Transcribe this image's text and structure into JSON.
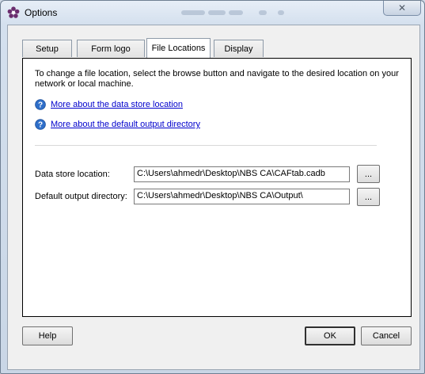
{
  "window": {
    "title": "Options",
    "close_glyph": "✕",
    "app_icon": "purple-flower-icon",
    "accent": "#6b2d6e"
  },
  "tabs": [
    {
      "label": "Setup",
      "active": false
    },
    {
      "label": "Form logo",
      "active": false
    },
    {
      "label": "File Locations",
      "active": true
    },
    {
      "label": "Display",
      "active": false
    }
  ],
  "panel": {
    "intro": "To change a file location, select the browse button and navigate to the desired location on your network or local machine.",
    "help_links": [
      {
        "text": "More about the data store location",
        "icon": "question-circle-icon"
      },
      {
        "text": "More about the default output directory",
        "icon": "question-circle-icon"
      }
    ],
    "fields": [
      {
        "label": "Data store location:",
        "value": "C:\\Users\\ahmedr\\Desktop\\NBS CA\\CAFtab.cadb",
        "browse_label": "..."
      },
      {
        "label": "Default output directory:",
        "value": "C:\\Users\\ahmedr\\Desktop\\NBS CA\\Output\\",
        "browse_label": "..."
      }
    ]
  },
  "footer": {
    "help_label": "Help",
    "ok_label": "OK",
    "cancel_label": "Cancel"
  }
}
